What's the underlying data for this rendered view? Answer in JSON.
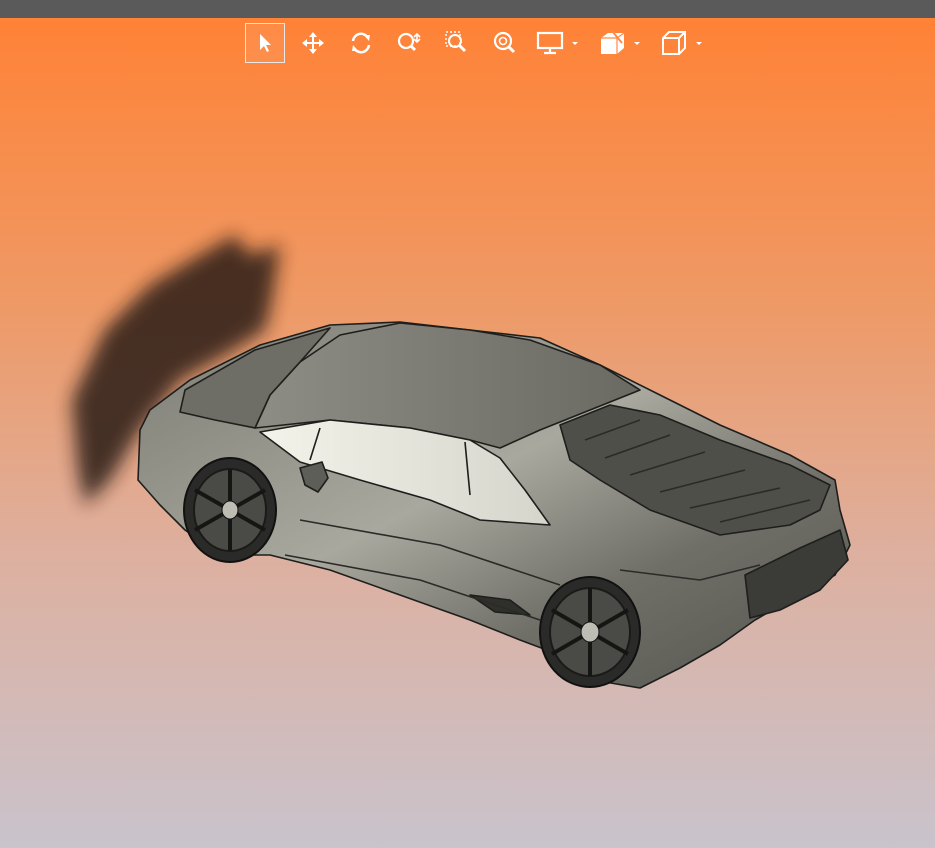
{
  "viewer": {
    "background_top": "#ff8236",
    "background_bottom": "#c9c3cc",
    "toolbar_icon_color": "#ffffff",
    "model_color": "#8a8a82"
  },
  "toolbar": {
    "tools": [
      {
        "id": "select",
        "icon": "cursor-arrow-icon",
        "active": true
      },
      {
        "id": "pan",
        "icon": "move-arrows-icon",
        "active": false
      },
      {
        "id": "rotate",
        "icon": "rotate-icon",
        "active": false
      },
      {
        "id": "zoom",
        "icon": "zoom-icon",
        "active": false
      },
      {
        "id": "zoom-window",
        "icon": "zoom-window-icon",
        "active": false
      },
      {
        "id": "zoom-fit",
        "icon": "zoom-fit-icon",
        "active": false
      },
      {
        "id": "display",
        "icon": "monitor-icon",
        "active": false,
        "dropdown": true
      },
      {
        "id": "section",
        "icon": "section-cube-icon",
        "active": false,
        "dropdown": true
      },
      {
        "id": "view-orientation",
        "icon": "cube-icon",
        "active": false,
        "dropdown": true
      }
    ]
  }
}
